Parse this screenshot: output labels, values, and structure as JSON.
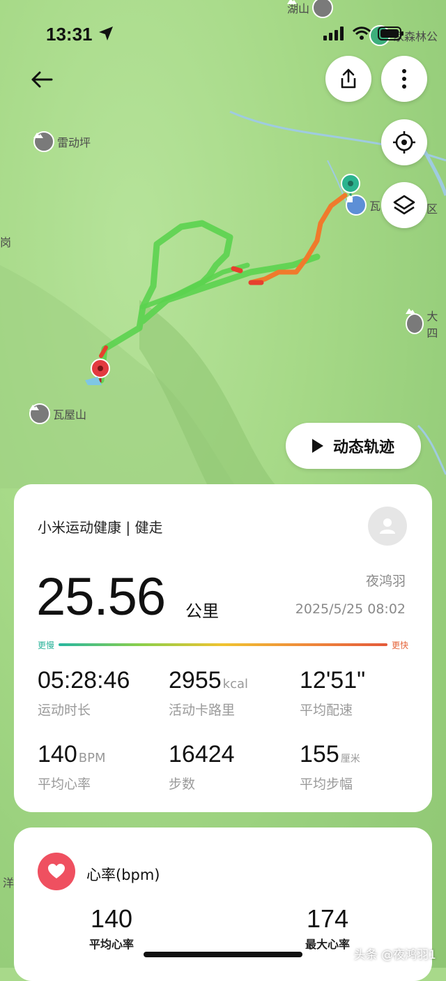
{
  "status_bar": {
    "time": "13:31"
  },
  "map": {
    "pois": [
      {
        "label": "湖山",
        "icon": "mountain-icon"
      },
      {
        "label": "雷动坪",
        "icon": "mountain-icon"
      },
      {
        "label": "瓦屋山",
        "icon": "mountain-icon"
      },
      {
        "label": "大四",
        "icon": "mountain-icon"
      },
      {
        "label": "瓦",
        "icon": "scenic-icon"
      },
      {
        "label": "区",
        "icon": ""
      },
      {
        "label": "家森林公",
        "icon": "park-icon"
      },
      {
        "label": "岗",
        "icon": ""
      },
      {
        "label": "洋",
        "icon": ""
      }
    ],
    "replay_button_label": "动态轨迹"
  },
  "summary": {
    "app_title": "小米运动健康 | 健走",
    "distance": "25.56",
    "distance_unit": "公里",
    "user_name": "夜鸿羽",
    "datetime": "2025/5/25 08:02",
    "pace_slow_label": "更慢",
    "pace_fast_label": "更快",
    "stats": [
      {
        "value": "05:28:46",
        "unit": "",
        "label": "运动时长"
      },
      {
        "value": "2955",
        "unit": "kcal",
        "label": "活动卡路里"
      },
      {
        "value": "12'51\"",
        "unit": "",
        "label": "平均配速"
      },
      {
        "value": "140",
        "unit": "BPM",
        "label": "平均心率"
      },
      {
        "value": "16424",
        "unit": "",
        "label": "步数"
      },
      {
        "value": "155",
        "unit": "厘米",
        "label": "平均步幅"
      }
    ]
  },
  "heart_rate": {
    "title": "心率(bpm)",
    "avg_value": "140",
    "avg_label": "平均心率",
    "max_value": "174",
    "max_label": "最大心率"
  },
  "watermark": "头条 @夜鸿羽1"
}
